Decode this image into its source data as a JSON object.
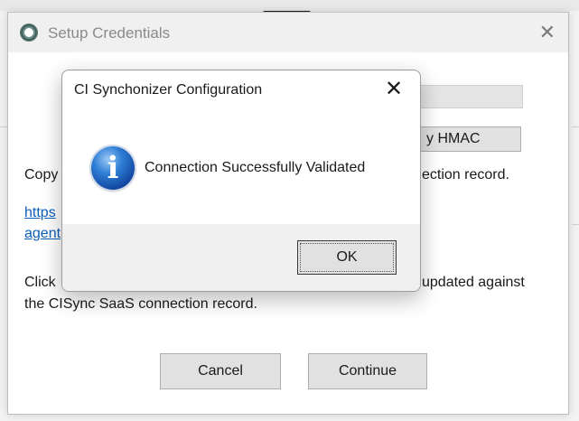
{
  "setup_window": {
    "title": "Setup Credentials",
    "hmac_button_label": "y HMAC",
    "copy_prefix": "Copy",
    "copy_suffix": "ection record.",
    "link_line1": "https",
    "link_line2": "agent",
    "click_prefix": "Click",
    "click_suffix": "updated against",
    "line2": "the CISync SaaS connection record.",
    "cancel_label": "Cancel",
    "continue_label": "Continue"
  },
  "modal": {
    "title": "CI Synchonizer Configuration",
    "message": "Connection Successfully Validated",
    "ok_label": "OK",
    "icon": "info-icon"
  }
}
